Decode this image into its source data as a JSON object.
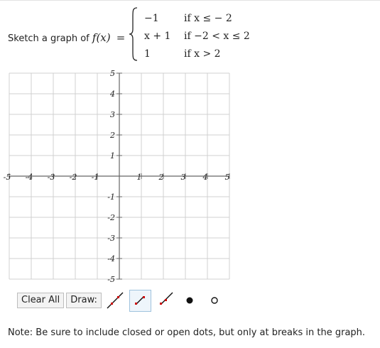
{
  "prompt": {
    "text": "Sketch a graph of",
    "function": "f(x)",
    "equals": "="
  },
  "pieces": [
    {
      "expr": "−1",
      "cond": "if  x ≤ − 2"
    },
    {
      "expr": "x + 1",
      "cond": "if  −2 < x ≤ 2"
    },
    {
      "expr": "1",
      "cond": "if  x > 2"
    }
  ],
  "graph": {
    "xlim": [
      -5,
      5
    ],
    "ylim": [
      -5,
      5
    ],
    "grid": true,
    "x_tick_labels": [
      "-5",
      "-4",
      "-3",
      "-2",
      "-1",
      "1",
      "2",
      "3",
      "4",
      "5"
    ],
    "y_tick_labels": [
      "5",
      "4",
      "3",
      "2",
      "1",
      "-1",
      "-2",
      "-3",
      "-4",
      "-5"
    ],
    "grid_color": "#d0d0d0",
    "axis_color": "#666666"
  },
  "toolbar": {
    "clear_label": "Clear All",
    "draw_label": "Draw:",
    "tools": [
      {
        "icon": "line-tool-icon",
        "selected": false
      },
      {
        "icon": "segment-tool-icon",
        "selected": true
      },
      {
        "icon": "ray-tool-icon",
        "selected": false
      },
      {
        "icon": "closed-dot-icon",
        "selected": false
      },
      {
        "icon": "open-dot-icon",
        "selected": false
      }
    ],
    "accent": "#cc0000"
  },
  "note": "Note: Be sure to include closed or open dots, but only at breaks in the graph."
}
